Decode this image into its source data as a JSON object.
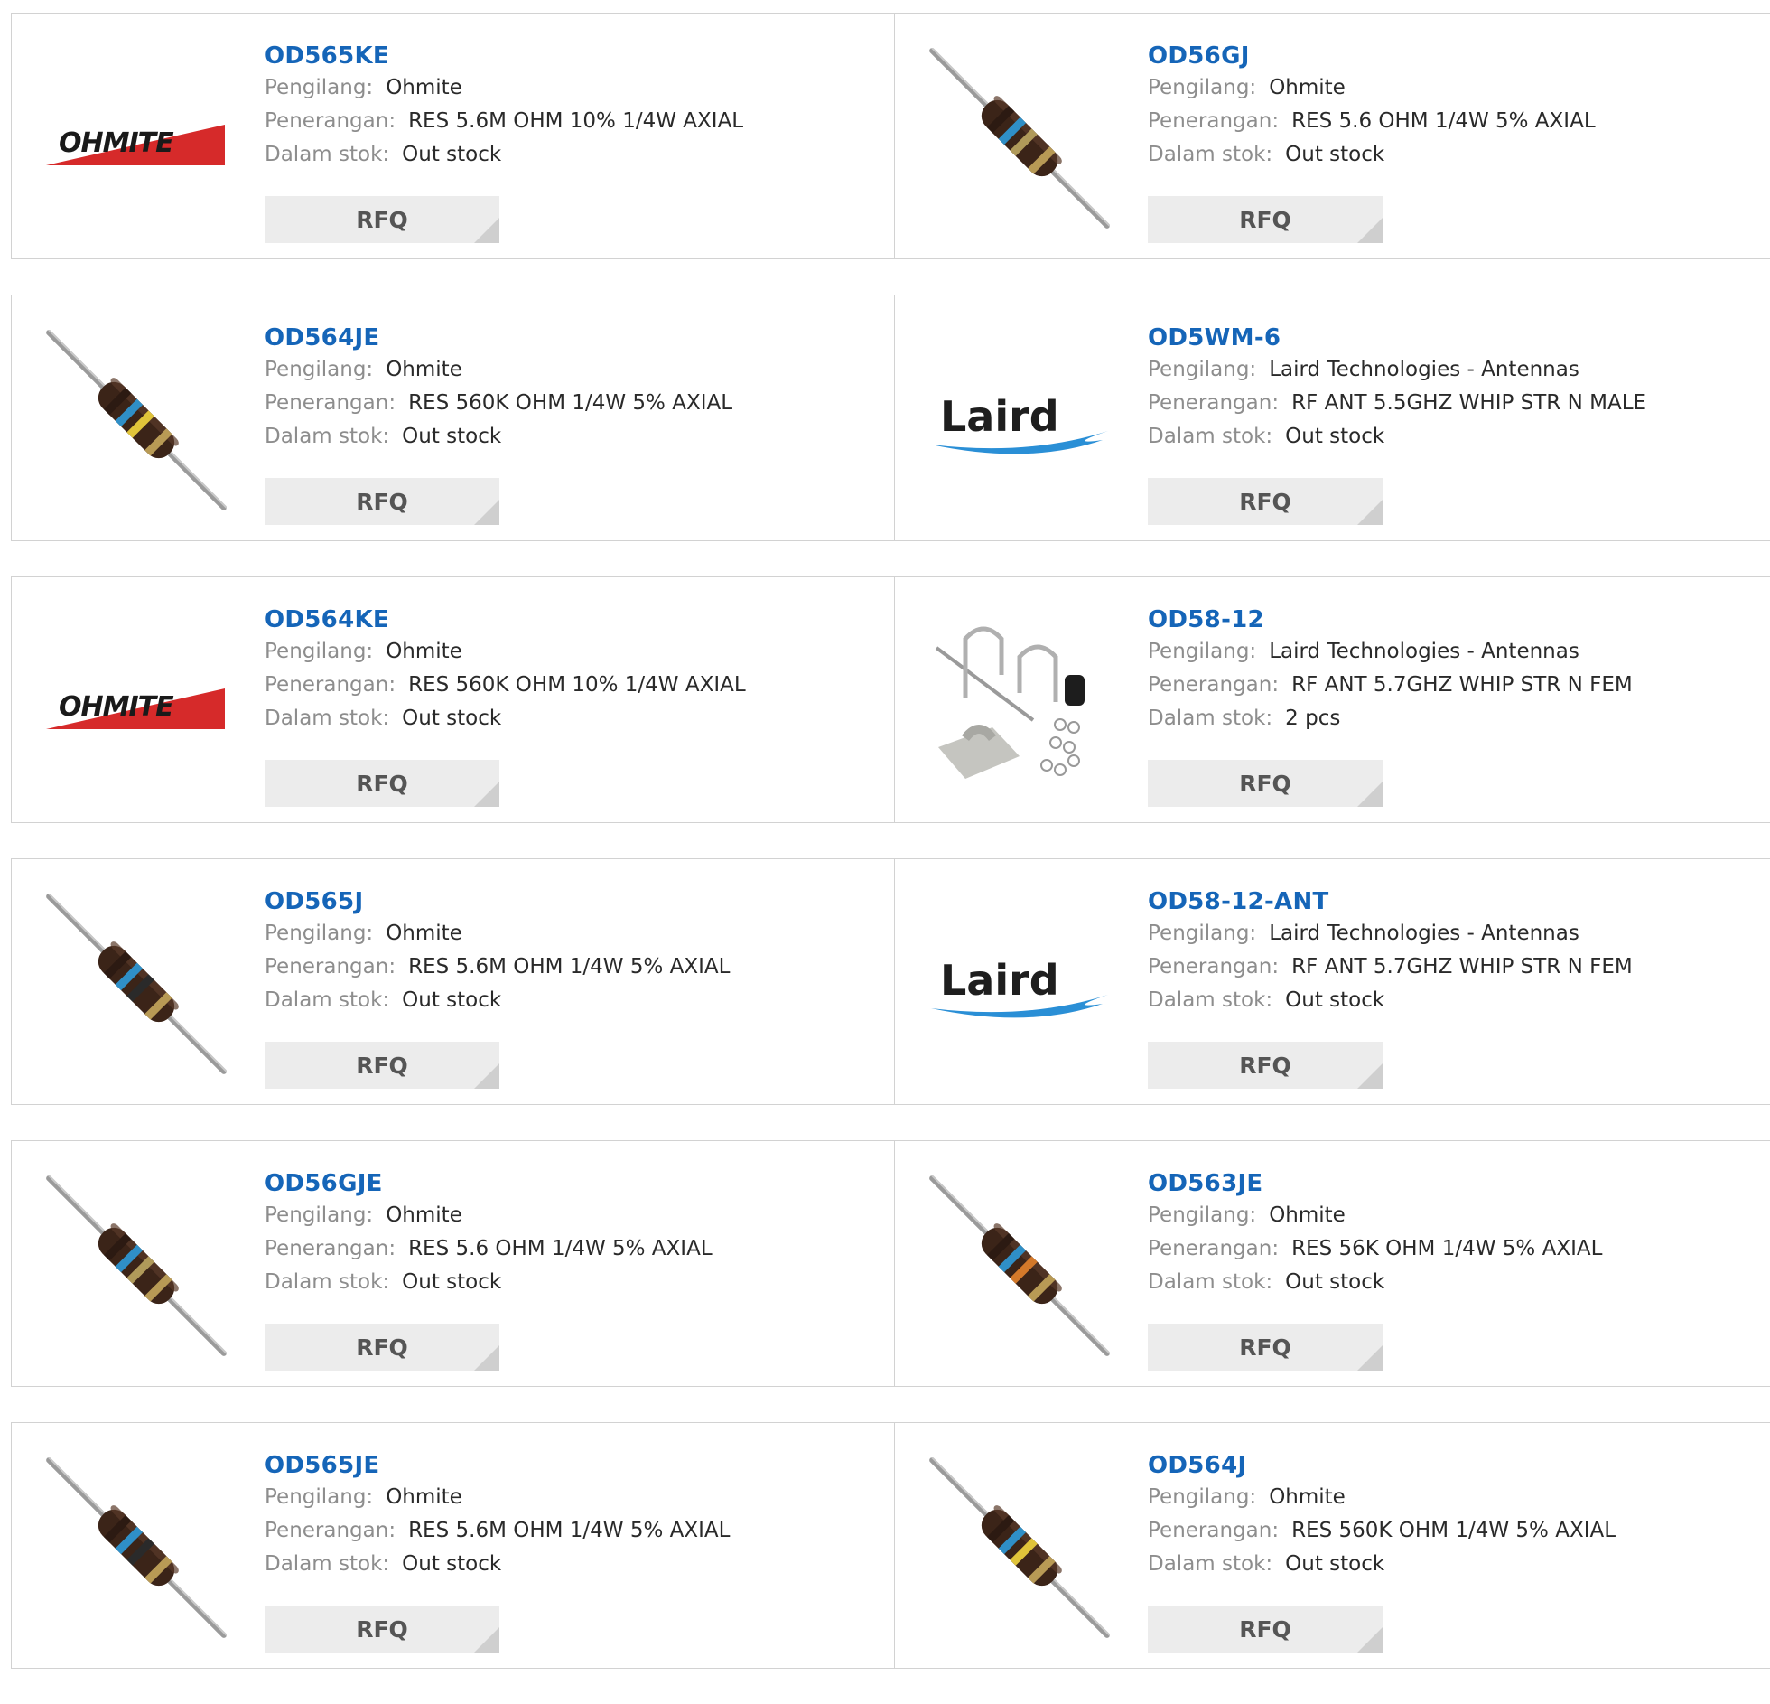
{
  "labels": {
    "manufacturer": "Pengilang:",
    "description": "Penerangan:",
    "stock": "Dalam stok:",
    "rfq": "RFQ"
  },
  "products": [
    {
      "part": "OD565KE",
      "manufacturer": "Ohmite",
      "description": "RES 5.6M OHM 10% 1/4W AXIAL",
      "stock": "Out stock",
      "image": "ohmite-logo"
    },
    {
      "part": "OD56GJ",
      "manufacturer": "Ohmite",
      "description": "RES 5.6 OHM 1/4W 5% AXIAL",
      "stock": "Out stock",
      "image": "resistor",
      "bands": [
        "#2c1a12",
        "#2f8fc7",
        "#b09a5a",
        "#b89a55"
      ]
    },
    {
      "part": "OD564JE",
      "manufacturer": "Ohmite",
      "description": "RES 560K OHM 1/4W 5% AXIAL",
      "stock": "Out stock",
      "image": "resistor",
      "bands": [
        "#2c1a12",
        "#2f8fc7",
        "#e0c43a",
        "#b89a55"
      ]
    },
    {
      "part": "OD5WM-6",
      "manufacturer": "Laird Technologies - Antennas",
      "description": "RF ANT 5.5GHZ WHIP STR N MALE",
      "stock": "Out stock",
      "image": "laird-logo"
    },
    {
      "part": "OD564KE",
      "manufacturer": "Ohmite",
      "description": "RES 560K OHM 10% 1/4W AXIAL",
      "stock": "Out stock",
      "image": "ohmite-logo"
    },
    {
      "part": "OD58-12",
      "manufacturer": "Laird Technologies - Antennas",
      "description": "RF ANT 5.7GHZ WHIP STR N FEM",
      "stock": "2 pcs",
      "image": "antenna-kit"
    },
    {
      "part": "OD565J",
      "manufacturer": "Ohmite",
      "description": "RES 5.6M OHM 1/4W 5% AXIAL",
      "stock": "Out stock",
      "image": "resistor",
      "bands": [
        "#2c1a12",
        "#2f8fc7",
        "#2a2a2a",
        "#b89a55"
      ]
    },
    {
      "part": "OD58-12-ANT",
      "manufacturer": "Laird Technologies - Antennas",
      "description": "RF ANT 5.7GHZ WHIP STR N FEM",
      "stock": "Out stock",
      "image": "laird-logo"
    },
    {
      "part": "OD56GJE",
      "manufacturer": "Ohmite",
      "description": "RES 5.6 OHM 1/4W 5% AXIAL",
      "stock": "Out stock",
      "image": "resistor",
      "bands": [
        "#2c1a12",
        "#2f8fc7",
        "#b09a5a",
        "#b89a55"
      ]
    },
    {
      "part": "OD563JE",
      "manufacturer": "Ohmite",
      "description": "RES 56K OHM 1/4W 5% AXIAL",
      "stock": "Out stock",
      "image": "resistor",
      "bands": [
        "#2c1a12",
        "#2f8fc7",
        "#d4792a",
        "#b89a55"
      ]
    },
    {
      "part": "OD565JE",
      "manufacturer": "Ohmite",
      "description": "RES 5.6M OHM 1/4W 5% AXIAL",
      "stock": "Out stock",
      "image": "resistor",
      "bands": [
        "#2c1a12",
        "#2f8fc7",
        "#2a2a2a",
        "#b89a55"
      ]
    },
    {
      "part": "OD564J",
      "manufacturer": "Ohmite",
      "description": "RES 560K OHM 1/4W 5% AXIAL",
      "stock": "Out stock",
      "image": "resistor",
      "bands": [
        "#2c1a12",
        "#2f8fc7",
        "#e0c43a",
        "#b89a55"
      ]
    }
  ]
}
